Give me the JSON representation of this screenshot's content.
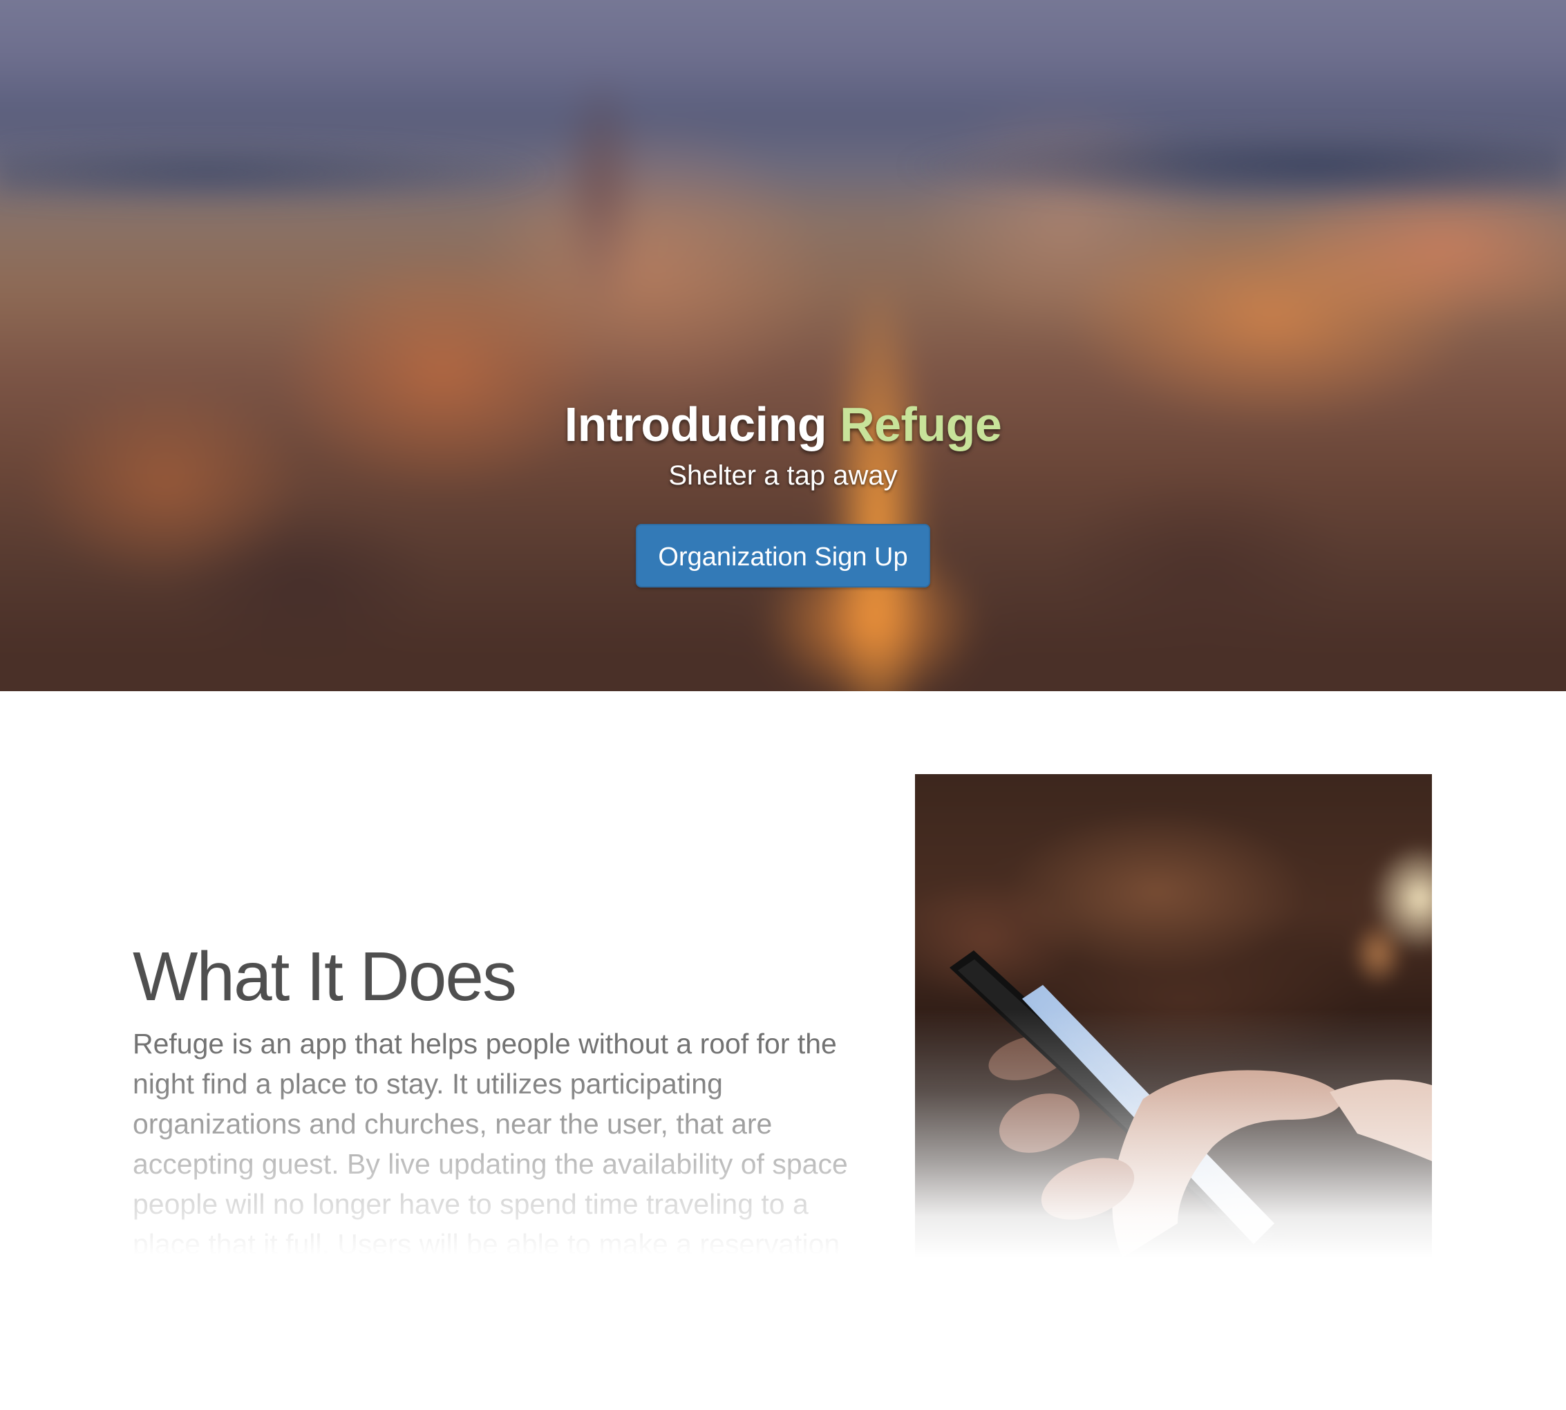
{
  "hero": {
    "title_prefix": "Introducing",
    "title_accent": "Refuge",
    "subtitle": "Shelter a tap away",
    "signup_button": "Organization Sign Up"
  },
  "feature": {
    "heading": "What It Does",
    "body": "Refuge is an app that helps people without a roof for the night find a place to stay. It utilizes participating organizations and churches, near the user, that are accepting guest. By live updating the availability of space people will no longer have to spend time traveling to a place that it full. Users will be able to make a reservation"
  },
  "colors": {
    "accent": "#c8e39a",
    "button": "#337ab7",
    "heading_text": "#4f4f4f"
  }
}
